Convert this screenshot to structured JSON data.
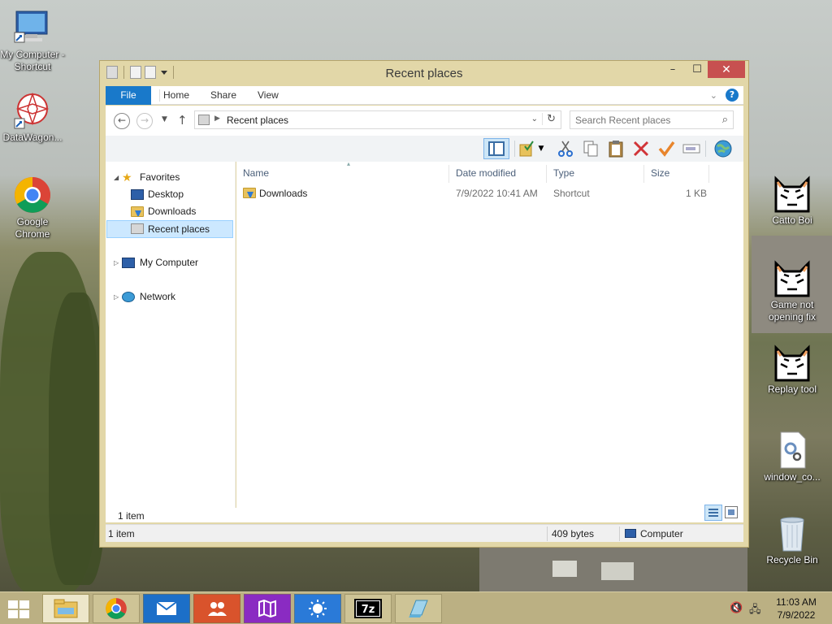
{
  "desktop": {
    "icons": [
      {
        "label": "My Computer - Shortcut"
      },
      {
        "label": "DataWagon..."
      },
      {
        "label": "Google Chrome"
      },
      {
        "label": "Catto Boi"
      },
      {
        "label": "Game not opening fix"
      },
      {
        "label": "Replay tool"
      },
      {
        "label": "window_co..."
      },
      {
        "label": "Recycle Bin"
      }
    ]
  },
  "window": {
    "title": "Recent places",
    "controls": {
      "minimize": "–",
      "maximize": "☐",
      "close": "✕"
    },
    "ribbon": {
      "tabs": [
        "File",
        "Home",
        "Share",
        "View"
      ],
      "help": "?"
    },
    "nav": {
      "back": "←",
      "forward": "→",
      "up": "↑",
      "address": "Recent places",
      "search_placeholder": "Search Recent places"
    },
    "tree": {
      "favorites": "Favorites",
      "desktop": "Desktop",
      "downloads": "Downloads",
      "recent_places": "Recent places",
      "my_computer": "My Computer",
      "network": "Network"
    },
    "columns": [
      "Name",
      "Date modified",
      "Type",
      "Size"
    ],
    "rows": [
      {
        "name": "Downloads",
        "date": "7/9/2022 10:41 AM",
        "type": "Shortcut",
        "size": "1 KB"
      }
    ],
    "inner_status": "1 item",
    "status": {
      "items": "1 item",
      "bytes": "409 bytes",
      "location": "Computer"
    }
  },
  "taskbar": {
    "time": "11:03 AM",
    "date": "7/9/2022"
  },
  "colors": {
    "accent": "#1979ca",
    "window_frame": "#e2d7a8",
    "selection": "#cce8ff"
  }
}
